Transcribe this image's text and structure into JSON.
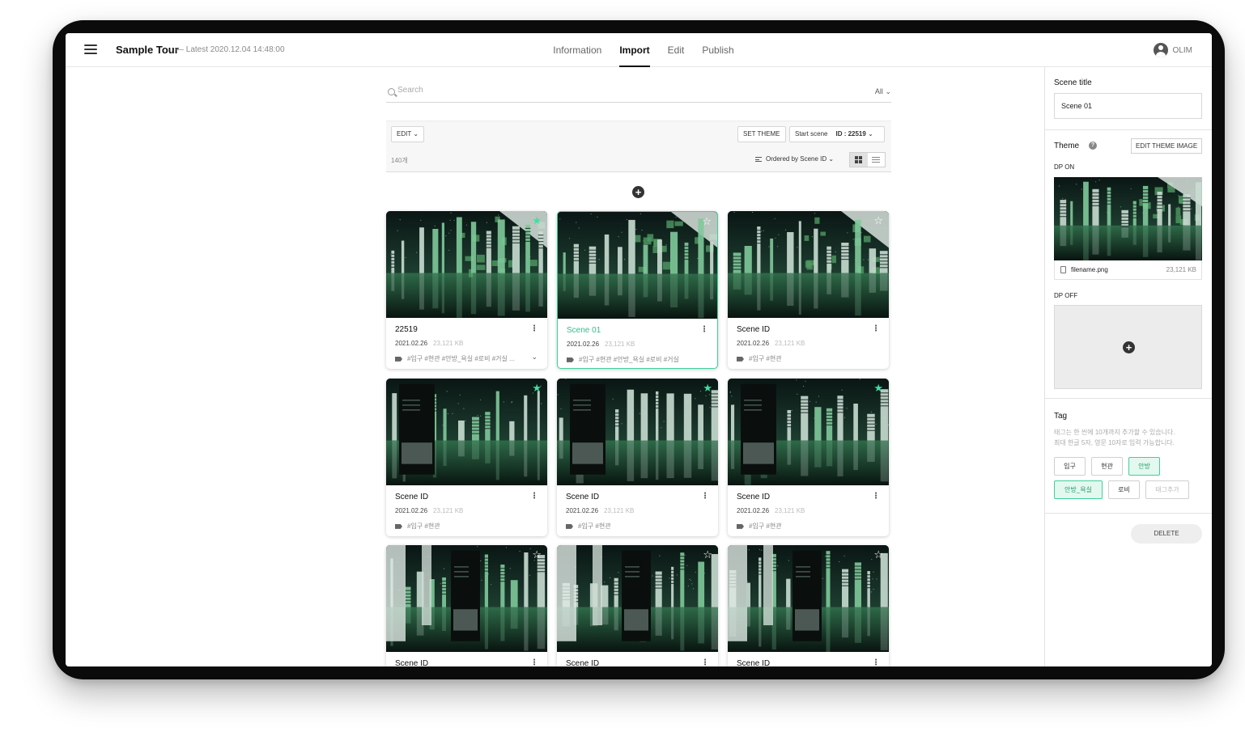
{
  "header": {
    "title": "Sample Tour",
    "subtitle": "— Latest 2020.12.04 14:48:00",
    "tabs": [
      {
        "label": "Information",
        "active": false
      },
      {
        "label": "Import",
        "active": true
      },
      {
        "label": "Edit",
        "active": false
      },
      {
        "label": "Publish",
        "active": false
      }
    ],
    "user": "OLIM"
  },
  "search": {
    "placeholder": "Search",
    "value": "",
    "filter": "All"
  },
  "toolbar": {
    "edit_label": "EDIT",
    "set_theme_label": "SET THEME",
    "start_scene_label": "Start scene",
    "start_scene_id": "ID : 22519",
    "count": "140개",
    "order_label": "Ordered by Scene ID",
    "view_mode": "grid"
  },
  "cards": [
    {
      "title": "22519",
      "date": "2021.02.26",
      "size": "23,121 KB",
      "tags": "#입구 #현관 #안방_욕실 #로비 #거실 ...",
      "starred": true,
      "selected": false,
      "variant": "a",
      "expandable": true
    },
    {
      "title": "Scene 01",
      "date": "2021.02.26",
      "size": "23,121 KB",
      "tags": "#입구 #현관 #안방_욕실 #로비 #거실",
      "starred": false,
      "selected": true,
      "variant": "a",
      "expandable": false
    },
    {
      "title": "Scene ID",
      "date": "2021.02.26",
      "size": "23,121 KB",
      "tags": "#입구 #현관",
      "starred": false,
      "selected": false,
      "variant": "a",
      "expandable": false
    },
    {
      "title": "Scene ID",
      "date": "2021.02.26",
      "size": "23,121 KB",
      "tags": "#입구 #현관",
      "starred": true,
      "selected": false,
      "variant": "b",
      "expandable": false
    },
    {
      "title": "Scene ID",
      "date": "2021.02.26",
      "size": "23,121 KB",
      "tags": "#입구 #현관",
      "starred": true,
      "selected": false,
      "variant": "c",
      "expandable": false
    },
    {
      "title": "Scene ID",
      "date": "2021.02.26",
      "size": "23,121 KB",
      "tags": "#입구 #현관",
      "starred": true,
      "selected": false,
      "variant": "c",
      "expandable": false
    },
    {
      "title": "Scene ID",
      "date": "",
      "size": "",
      "tags": "",
      "starred": false,
      "selected": false,
      "variant": "d",
      "expandable": false
    },
    {
      "title": "Scene ID",
      "date": "",
      "size": "",
      "tags": "",
      "starred": false,
      "selected": false,
      "variant": "d",
      "expandable": false
    },
    {
      "title": "Scene ID",
      "date": "",
      "size": "",
      "tags": "",
      "starred": false,
      "selected": false,
      "variant": "d",
      "expandable": false
    }
  ],
  "panel": {
    "scene_title_label": "Scene title",
    "scene_title_value": "Scene 01",
    "theme_label": "Theme",
    "edit_theme_label": "EDIT THEME IMAGE",
    "dp_on_label": "DP ON",
    "file_name": "filename.png",
    "file_size": "23,121 KB",
    "dp_off_label": "DP OFF",
    "tag_label": "Tag",
    "tag_help_1": "태그는 한 씬에 10개까지 추가할 수 있습니다.",
    "tag_help_2": "최대 한글 5자, 영문 10자로 입력 가능합니다.",
    "tags": [
      {
        "label": "입구",
        "on": false
      },
      {
        "label": "현관",
        "on": false
      },
      {
        "label": "안방",
        "on": true
      },
      {
        "label": "안방_욕실",
        "on": true
      },
      {
        "label": "로비",
        "on": false
      }
    ],
    "tag_add_label": "태그추가",
    "delete_label": "DELETE"
  },
  "colors": {
    "accent": "#3fcf9b",
    "accent_text": "#2fbf88",
    "frame": "#0b0b0b"
  }
}
